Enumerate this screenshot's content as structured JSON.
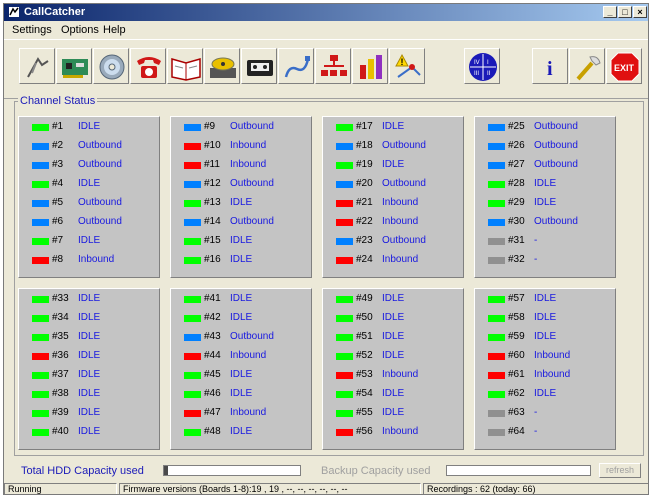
{
  "window": {
    "title": "CallCatcher"
  },
  "menu": [
    "Settings",
    "Options",
    "Help"
  ],
  "toolbar": {
    "buttons": [
      {
        "icon": "antenna-icon"
      },
      {
        "icon": "circuit-board-icon"
      },
      {
        "icon": "cd-disc-icon"
      },
      {
        "icon": "telephone-icon"
      },
      {
        "icon": "book-icon"
      },
      {
        "icon": "tape-drive-icon"
      },
      {
        "icon": "cassette-icon"
      },
      {
        "icon": "cable-icon"
      },
      {
        "icon": "network-tree-icon"
      },
      {
        "icon": "bar-chart-icon"
      },
      {
        "icon": "alert-icon"
      },
      {
        "icon": "clock-icon",
        "label": "IV I III II"
      },
      {
        "icon": "info-icon",
        "label": "i"
      },
      {
        "icon": "tools-icon"
      },
      {
        "icon": "exit-icon",
        "label": "EXIT"
      }
    ]
  },
  "colors": {
    "idle": "#00ff00",
    "outbound": "#0080ff",
    "inbound": "#ff0000",
    "unused": "#909090",
    "status_text": "#1818e0"
  },
  "channel_status": {
    "label": "Channel Status",
    "panels": [
      [
        {
          "num": "#1",
          "status": "IDLE",
          "state": "idle"
        },
        {
          "num": "#2",
          "status": "Outbound",
          "state": "outbound"
        },
        {
          "num": "#3",
          "status": "Outbound",
          "state": "outbound"
        },
        {
          "num": "#4",
          "status": "IDLE",
          "state": "idle"
        },
        {
          "num": "#5",
          "status": "Outbound",
          "state": "outbound"
        },
        {
          "num": "#6",
          "status": "Outbound",
          "state": "outbound"
        },
        {
          "num": "#7",
          "status": "IDLE",
          "state": "idle"
        },
        {
          "num": "#8",
          "status": "Inbound",
          "state": "inbound"
        }
      ],
      [
        {
          "num": "#9",
          "status": "Outbound",
          "state": "outbound"
        },
        {
          "num": "#10",
          "status": "Inbound",
          "state": "inbound"
        },
        {
          "num": "#11",
          "status": "Inbound",
          "state": "inbound"
        },
        {
          "num": "#12",
          "status": "Outbound",
          "state": "outbound"
        },
        {
          "num": "#13",
          "status": "IDLE",
          "state": "idle"
        },
        {
          "num": "#14",
          "status": "Outbound",
          "state": "outbound"
        },
        {
          "num": "#15",
          "status": "IDLE",
          "state": "idle"
        },
        {
          "num": "#16",
          "status": "IDLE",
          "state": "idle"
        }
      ],
      [
        {
          "num": "#17",
          "status": "IDLE",
          "state": "idle"
        },
        {
          "num": "#18",
          "status": "Outbound",
          "state": "outbound"
        },
        {
          "num": "#19",
          "status": "IDLE",
          "state": "idle"
        },
        {
          "num": "#20",
          "status": "Outbound",
          "state": "outbound"
        },
        {
          "num": "#21",
          "status": "Inbound",
          "state": "inbound"
        },
        {
          "num": "#22",
          "status": "Inbound",
          "state": "inbound"
        },
        {
          "num": "#23",
          "status": "Outbound",
          "state": "outbound"
        },
        {
          "num": "#24",
          "status": "Inbound",
          "state": "inbound"
        }
      ],
      [
        {
          "num": "#25",
          "status": "Outbound",
          "state": "outbound"
        },
        {
          "num": "#26",
          "status": "Outbound",
          "state": "outbound"
        },
        {
          "num": "#27",
          "status": "Outbound",
          "state": "outbound"
        },
        {
          "num": "#28",
          "status": "IDLE",
          "state": "idle"
        },
        {
          "num": "#29",
          "status": "IDLE",
          "state": "idle"
        },
        {
          "num": "#30",
          "status": "Outbound",
          "state": "outbound"
        },
        {
          "num": "#31",
          "status": "-",
          "state": "unused"
        },
        {
          "num": "#32",
          "status": "-",
          "state": "unused"
        }
      ],
      [
        {
          "num": "#33",
          "status": "IDLE",
          "state": "idle"
        },
        {
          "num": "#34",
          "status": "IDLE",
          "state": "idle"
        },
        {
          "num": "#35",
          "status": "IDLE",
          "state": "idle"
        },
        {
          "num": "#36",
          "status": "IDLE",
          "state": "inbound"
        },
        {
          "num": "#37",
          "status": "IDLE",
          "state": "idle"
        },
        {
          "num": "#38",
          "status": "IDLE",
          "state": "idle"
        },
        {
          "num": "#39",
          "status": "IDLE",
          "state": "idle"
        },
        {
          "num": "#40",
          "status": "IDLE",
          "state": "idle"
        }
      ],
      [
        {
          "num": "#41",
          "status": "IDLE",
          "state": "idle"
        },
        {
          "num": "#42",
          "status": "IDLE",
          "state": "idle"
        },
        {
          "num": "#43",
          "status": "Outbound",
          "state": "outbound"
        },
        {
          "num": "#44",
          "status": "Inbound",
          "state": "inbound"
        },
        {
          "num": "#45",
          "status": "IDLE",
          "state": "idle"
        },
        {
          "num": "#46",
          "status": "IDLE",
          "state": "idle"
        },
        {
          "num": "#47",
          "status": "Inbound",
          "state": "inbound"
        },
        {
          "num": "#48",
          "status": "IDLE",
          "state": "idle"
        }
      ],
      [
        {
          "num": "#49",
          "status": "IDLE",
          "state": "idle"
        },
        {
          "num": "#50",
          "status": "IDLE",
          "state": "idle"
        },
        {
          "num": "#51",
          "status": "IDLE",
          "state": "idle"
        },
        {
          "num": "#52",
          "status": "IDLE",
          "state": "idle"
        },
        {
          "num": "#53",
          "status": "Inbound",
          "state": "inbound"
        },
        {
          "num": "#54",
          "status": "IDLE",
          "state": "idle"
        },
        {
          "num": "#55",
          "status": "IDLE",
          "state": "idle"
        },
        {
          "num": "#56",
          "status": "Inbound",
          "state": "inbound"
        }
      ],
      [
        {
          "num": "#57",
          "status": "IDLE",
          "state": "idle"
        },
        {
          "num": "#58",
          "status": "IDLE",
          "state": "idle"
        },
        {
          "num": "#59",
          "status": "IDLE",
          "state": "idle"
        },
        {
          "num": "#60",
          "status": "Inbound",
          "state": "inbound"
        },
        {
          "num": "#61",
          "status": "Inbound",
          "state": "inbound"
        },
        {
          "num": "#62",
          "status": "IDLE",
          "state": "idle"
        },
        {
          "num": "#63",
          "status": "-",
          "state": "unused"
        },
        {
          "num": "#64",
          "status": "-",
          "state": "unused"
        }
      ]
    ]
  },
  "capacity": {
    "hdd_label": "Total HDD Capacity used",
    "hdd_fraction": 0.03,
    "backup_label": "Backup Capacity used",
    "backup_fraction": 0,
    "refresh_label": "refresh"
  },
  "statusbar": {
    "state": "Running",
    "firmware": "Firmware versions (Boards 1-8):19 , 19 , --, --, --, --, --, --",
    "recordings": "Recordings : 62 (today: 66)"
  }
}
